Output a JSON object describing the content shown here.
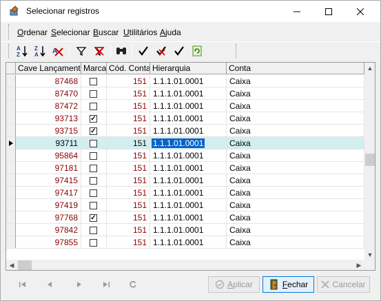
{
  "window": {
    "title": "Selecionar registros"
  },
  "menu": [
    {
      "label": "Ordenar",
      "underline": "O",
      "rest": "rdenar"
    },
    {
      "label": "Selecionar",
      "underline": "S",
      "rest": "elecionar"
    },
    {
      "label": "Buscar",
      "underline": "B",
      "rest": "uscar"
    },
    {
      "label": "Utilitários",
      "underline": "U",
      "rest": "tilitários"
    },
    {
      "label": "Ajuda",
      "underline": "A",
      "rest": "juda"
    }
  ],
  "toolbar": {
    "icons": [
      "sort-ascending-icon",
      "sort-descending-icon",
      "clear-sort-icon",
      "filter-icon",
      "clear-filter-icon",
      "find-icon",
      "check-icon",
      "uncheck-icon",
      "check-all-icon",
      "refresh-icon"
    ]
  },
  "grid": {
    "columns": [
      "Cave Lançamento",
      "Marcar",
      "Cód. Conta",
      "Hierarquia",
      "Conta"
    ],
    "rows": [
      {
        "key": "87468",
        "checked": false,
        "cod": "151",
        "hier": "1.1.1.01.0001",
        "conta": "Caixa"
      },
      {
        "key": "87470",
        "checked": false,
        "cod": "151",
        "hier": "1.1.1.01.0001",
        "conta": "Caixa"
      },
      {
        "key": "87472",
        "checked": false,
        "cod": "151",
        "hier": "1.1.1.01.0001",
        "conta": "Caixa"
      },
      {
        "key": "93713",
        "checked": true,
        "cod": "151",
        "hier": "1.1.1.01.0001",
        "conta": "Caixa"
      },
      {
        "key": "93715",
        "checked": true,
        "cod": "151",
        "hier": "1.1.1.01.0001",
        "conta": "Caixa"
      },
      {
        "key": "93711",
        "checked": false,
        "cod": "151",
        "hier": "1.1.1.01.0001",
        "conta": "Caixa",
        "selected": true
      },
      {
        "key": "95864",
        "checked": false,
        "cod": "151",
        "hier": "1.1.1.01.0001",
        "conta": "Caixa"
      },
      {
        "key": "97181",
        "checked": false,
        "cod": "151",
        "hier": "1.1.1.01.0001",
        "conta": "Caixa"
      },
      {
        "key": "97415",
        "checked": false,
        "cod": "151",
        "hier": "1.1.1.01.0001",
        "conta": "Caixa"
      },
      {
        "key": "97417",
        "checked": false,
        "cod": "151",
        "hier": "1.1.1.01.0001",
        "conta": "Caixa"
      },
      {
        "key": "97419",
        "checked": false,
        "cod": "151",
        "hier": "1.1.1.01.0001",
        "conta": "Caixa"
      },
      {
        "key": "97768",
        "checked": true,
        "cod": "151",
        "hier": "1.1.1.01.0001",
        "conta": "Caixa"
      },
      {
        "key": "97842",
        "checked": false,
        "cod": "151",
        "hier": "1.1.1.01.0001",
        "conta": "Caixa"
      },
      {
        "key": "97855",
        "checked": false,
        "cod": "151",
        "hier": "1.1.1.01.0001",
        "conta": "Caixa"
      }
    ]
  },
  "footer": {
    "apply": {
      "underline": "A",
      "rest": "plicar"
    },
    "close": {
      "underline": "F",
      "rest": "echar"
    },
    "cancel": {
      "text": "Cancelar"
    }
  },
  "colors": {
    "key_text": "#8b0000",
    "selected_row": "#d2eef1",
    "highlight": "#0a64c8"
  }
}
